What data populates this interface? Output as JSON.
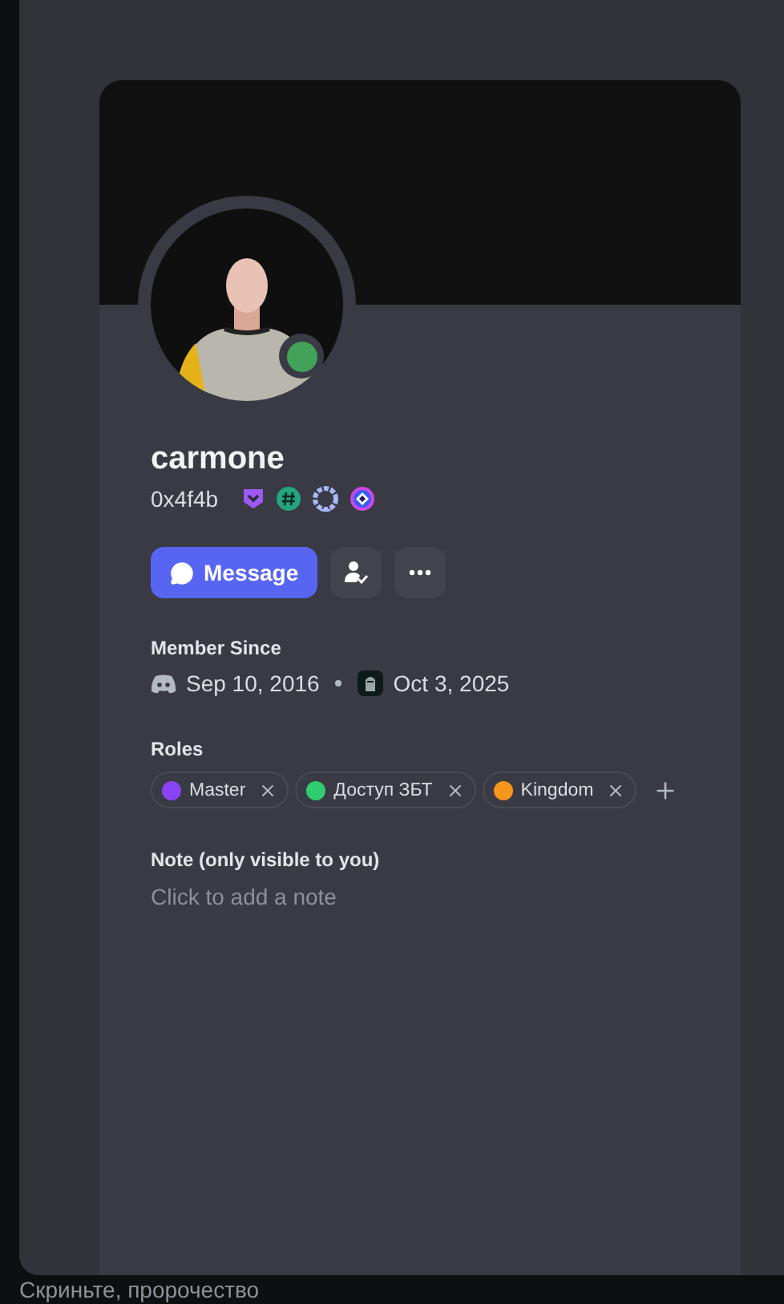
{
  "profile": {
    "username": "carmone",
    "tag": "0x4f4b",
    "online": true,
    "badges": [
      {
        "kind": "shield"
      },
      {
        "kind": "hashtag"
      },
      {
        "kind": "laurel"
      },
      {
        "kind": "orb"
      }
    ],
    "message_button": "Message",
    "member_since": {
      "label": "Member Since",
      "dates": [
        {
          "kind": "discord",
          "date": "Sep 10, 2016"
        },
        {
          "kind": "server",
          "date": "Oct 3, 2025"
        }
      ]
    },
    "roles": {
      "label": "Roles",
      "items": [
        {
          "name": "Master",
          "color": "#8a43f5"
        },
        {
          "name": "Доступ ЗБТ",
          "color": "#2fcc71"
        },
        {
          "name": "Kingdom",
          "color": "#f7961d"
        }
      ]
    },
    "note": {
      "label": "Note (only visible to you)",
      "placeholder": "Click to add a note"
    }
  },
  "background_text": "Скриньте, пророчество"
}
